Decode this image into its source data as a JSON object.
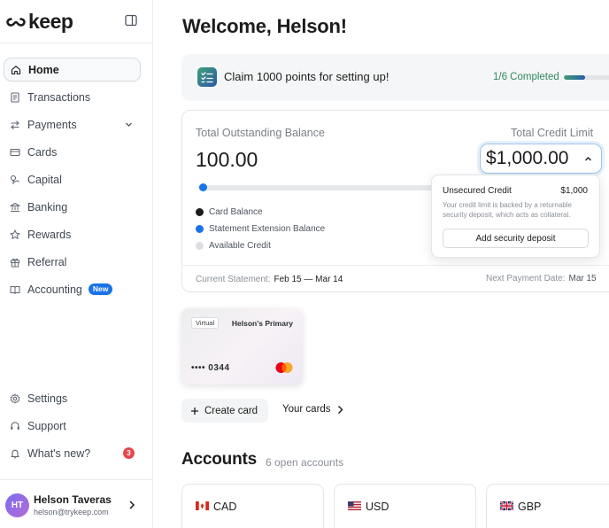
{
  "brand": {
    "name": "keep"
  },
  "sidebar": {
    "items": [
      {
        "label": "Home",
        "icon": "home-icon",
        "active": true
      },
      {
        "label": "Transactions",
        "icon": "receipt-icon"
      },
      {
        "label": "Payments",
        "icon": "transfer-icon",
        "expandable": true
      },
      {
        "label": "Cards",
        "icon": "card-icon"
      },
      {
        "label": "Capital",
        "icon": "capital-icon"
      },
      {
        "label": "Banking",
        "icon": "bank-icon"
      },
      {
        "label": "Rewards",
        "icon": "star-icon"
      },
      {
        "label": "Referral",
        "icon": "gift-icon"
      },
      {
        "label": "Accounting",
        "icon": "book-icon",
        "badge": "New"
      }
    ],
    "bottom_items": [
      {
        "label": "Settings",
        "icon": "gear-icon"
      },
      {
        "label": "Support",
        "icon": "headset-icon"
      },
      {
        "label": "What's new?",
        "icon": "bell-icon",
        "count": "3"
      }
    ],
    "user": {
      "initials": "HT",
      "name": "Helson Taveras",
      "email": "helson@trykeep.com"
    }
  },
  "main": {
    "welcome": "Welcome, Helson!",
    "claim": {
      "text": "Claim 1000 points for setting up!",
      "progress_text": "1/6 Completed",
      "progress_fraction": 0.1667
    },
    "balance": {
      "outstanding_label": "Total Outstanding Balance",
      "outstanding_value": "100.00",
      "credit_limit_label": "Total Credit Limit",
      "credit_limit_value": "$1,000.00",
      "legend": [
        {
          "label": "Card Balance",
          "color": "#1c1c1c"
        },
        {
          "label": "Statement Extension Balance",
          "color": "#1a73e8"
        },
        {
          "label": "Available Credit",
          "color": "#dcdee1"
        }
      ],
      "current_statement_label": "Current Statement:",
      "current_statement_value": "Feb 15 — Mar 14",
      "next_payment_label": "Next Payment Date:",
      "next_payment_value": "Mar 15"
    },
    "popover": {
      "title": "Unsecured Credit",
      "amount": "$1,000",
      "description": "Your credit limit is backed by a returnable security deposit, which acts as collateral.",
      "button": "Add security deposit"
    },
    "card": {
      "tag": "Virtual",
      "name": "Helson's Primary",
      "number": "•••• 0344",
      "network_icon": "mastercard-icon"
    },
    "actions": {
      "create_card": "Create card",
      "your_cards": "Your cards"
    },
    "accounts": {
      "title": "Accounts",
      "count_text": "6 open accounts",
      "items": [
        {
          "label": "CAD",
          "flag": "canada-flag-icon"
        },
        {
          "label": "USD",
          "flag": "usa-flag-icon"
        },
        {
          "label": "GBP",
          "flag": "uk-flag-icon"
        }
      ]
    }
  }
}
